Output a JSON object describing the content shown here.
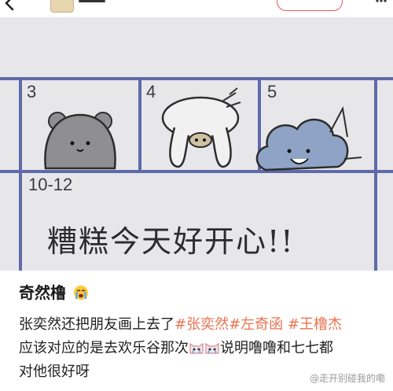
{
  "post": {
    "title": "奇然橹",
    "title_emoji": "loudly-crying-face-icon",
    "body_line1_prefix": "张奕然还把朋友画上去了",
    "hashtags": [
      "#张奕然",
      "#左奇函",
      " #王橹杰"
    ],
    "body_line2": "应该对应的是去欢乐谷那次",
    "body_line2_emojis": [
      "crying-cat-icon",
      "crying-cat-icon"
    ],
    "body_line2_suffix": "说明噜噜和七七都",
    "body_line3": "对他很好呀",
    "tag_color": "#eb7350"
  },
  "photo": {
    "cells": [
      "3",
      "4",
      "5",
      "10-12"
    ],
    "handwriting": "糟糕今天好开心!!"
  },
  "watermark": "@走开别碰我的嘞"
}
